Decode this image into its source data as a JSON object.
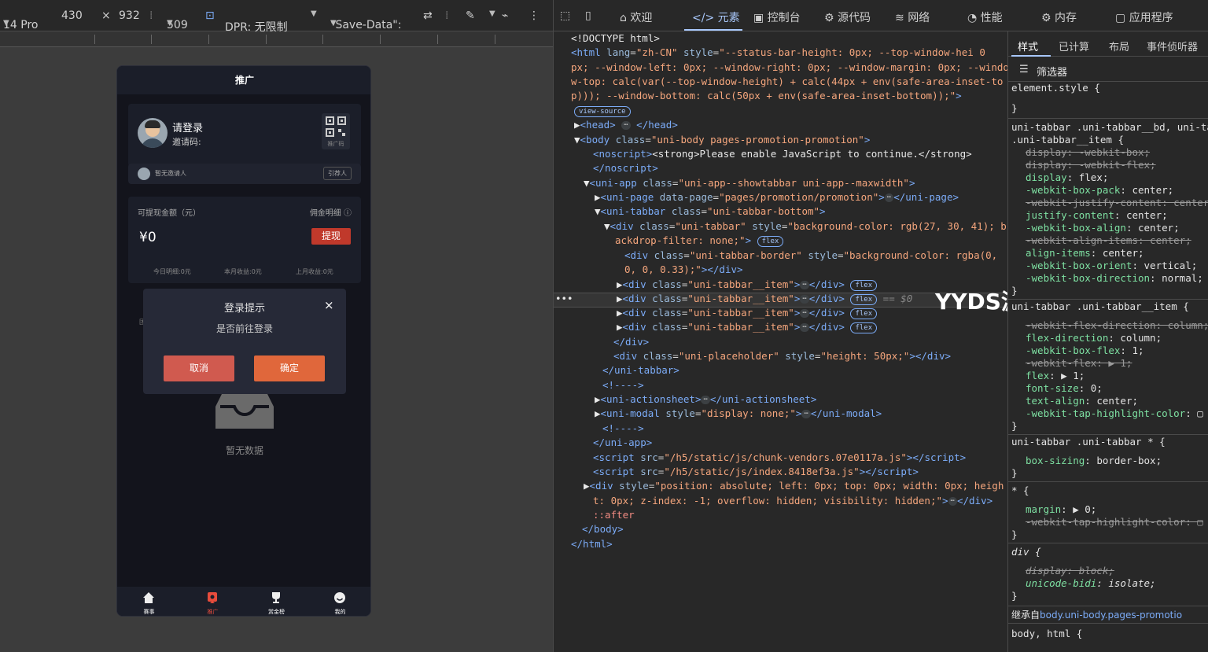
{
  "device_toolbar": {
    "device": "14 Pro",
    "width": "430",
    "x": "×",
    "height": "932",
    "zoom": "509",
    "dpr": "DPR: 无限制",
    "save_data": "\"Save-Data\":"
  },
  "phone": {
    "header_title": "推广",
    "login_text": "请登录",
    "invite_code": "邀请码:",
    "qr_label": "推广码",
    "inviter_text": "暂无邀请人",
    "inviter_button": "引荐人",
    "fund_label": "可提现金额（元）",
    "fund_detail": "佣金明细 ⓘ",
    "fund_amount": "¥0",
    "withdraw": "提现",
    "stats": [
      "今日明细:0元",
      "本月收益:0元",
      "上月收益:0元"
    ],
    "left_mark": "团",
    "empty_text": "暂无数据",
    "modal": {
      "title": "登录提示",
      "close": "×",
      "message": "是否前往登录",
      "cancel": "取消",
      "confirm": "确定"
    },
    "tabs": [
      "赛事",
      "推广",
      "赏金榜",
      "我的"
    ]
  },
  "devtools": {
    "tabs": [
      "欢迎",
      "元素",
      "控制台",
      "源代码",
      "网络",
      "性能",
      "内存",
      "应用程序"
    ],
    "active_tab": "元素",
    "watermark": "YYDS源码网",
    "styles_tabs": [
      "样式",
      "已计算",
      "布局",
      "事件侦听器"
    ],
    "filter_label": "筛选器",
    "inherited_label": "继承自",
    "inherited_link": "body.uni-body.pages-promotio"
  },
  "colors": {
    "accent": "#a8c7fa",
    "withdraw": "#c0392b",
    "cancel": "#d05a4f",
    "confirm": "#e0673b",
    "active_tab_icon": "#e74c3c"
  }
}
